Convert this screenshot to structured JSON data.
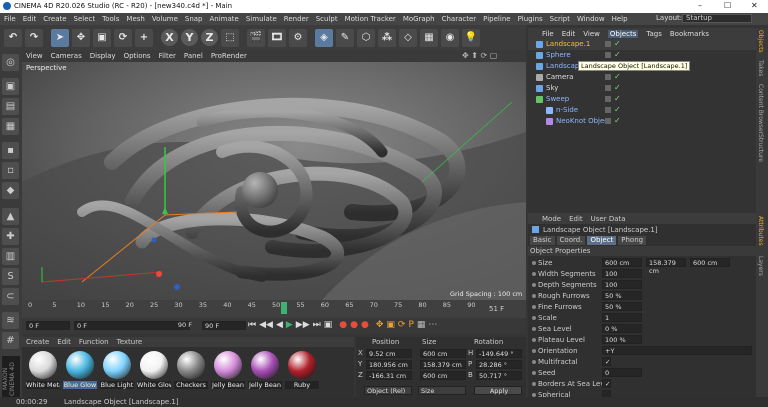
{
  "window": {
    "title": "CINEMA 4D R20.026 Studio (RC - R20) - [new340.c4d *] - Main"
  },
  "menu": [
    "File",
    "Edit",
    "Create",
    "Select",
    "Tools",
    "Mesh",
    "Volume",
    "Snap",
    "Animate",
    "Simulate",
    "Render",
    "Sculpt",
    "Motion Tracker",
    "MoGraph",
    "Character",
    "Pipeline",
    "Plugins",
    "Script",
    "Window",
    "Help"
  ],
  "layout": {
    "label": "Layout:",
    "value": "Startup"
  },
  "toolbar": {
    "axes": [
      "X",
      "Y",
      "Z"
    ]
  },
  "viewport": {
    "menu": [
      "View",
      "Cameras",
      "Display",
      "Options",
      "Filter",
      "Panel",
      "ProRender"
    ],
    "label": "Perspective",
    "grid_spacing": "Grid Spacing : 100 cm"
  },
  "timeline": {
    "ticks": [
      "0",
      "5",
      "10",
      "15",
      "20",
      "25",
      "30",
      "35",
      "40",
      "45",
      "50",
      "55",
      "60",
      "65",
      "70",
      "75",
      "80",
      "85",
      "90"
    ],
    "current": "51 F",
    "current_mark": "51"
  },
  "transport": {
    "start": "0 F",
    "cur": "0 F",
    "end1": "90 F",
    "end2": "90 F"
  },
  "materials": {
    "menu": [
      "Create",
      "Edit",
      "Function",
      "Texture"
    ],
    "items": [
      {
        "name": "White Meta",
        "color": "#d9d9d9"
      },
      {
        "name": "Blue Glow",
        "color": "#49b6e0"
      },
      {
        "name": "Blue Light",
        "color": "#7fd3ff"
      },
      {
        "name": "White Glow",
        "color": "#f2f2f2"
      },
      {
        "name": "Checkers",
        "color": "#888888"
      },
      {
        "name": "Jelly Bean",
        "color": "#d48cd9"
      },
      {
        "name": "Jelly Bean",
        "color": "#a84fb5"
      },
      {
        "name": "Ruby",
        "color": "#b0202a"
      }
    ]
  },
  "coords": {
    "headers": [
      "Position",
      "Size",
      "Rotation"
    ],
    "rows": [
      {
        "axis": "X",
        "pos": "9.52 cm",
        "size": "600 cm",
        "rl": "H",
        "rot": "-149.649 °"
      },
      {
        "axis": "Y",
        "pos": "180.956 cm",
        "size": "158.379 cm",
        "rl": "P",
        "rot": "28.286 °"
      },
      {
        "axis": "Z",
        "pos": "-166.31 cm",
        "size": "600 cm",
        "rl": "B",
        "rot": "50.717 °"
      }
    ],
    "mode": "Object (Rel)",
    "size_mode": "Size",
    "apply": "Apply"
  },
  "objmgr": {
    "tabs": [
      "File",
      "Edit",
      "View",
      "Objects",
      "Tags",
      "Bookmarks"
    ],
    "objects": [
      {
        "name": "Landscape.1",
        "indent": 0,
        "color": "#6aa6e8"
      },
      {
        "name": "Sphere",
        "indent": 0,
        "color": "#6aa6e8"
      },
      {
        "name": "Landscape",
        "indent": 0,
        "color": "#6aa6e8"
      },
      {
        "name": "Camera",
        "indent": 0,
        "color": "#aaaaaa"
      },
      {
        "name": "Sky",
        "indent": 0,
        "color": "#6aa6e8"
      },
      {
        "name": "Sweep",
        "indent": 0,
        "color": "#66c466"
      },
      {
        "name": "n-Side",
        "indent": 1,
        "color": "#8fb7ff"
      },
      {
        "name": "NeoKnot Object",
        "indent": 1,
        "color": "#b38ae6"
      }
    ],
    "tooltip": "Landscape Object [Landscape.1]"
  },
  "attrmgr": {
    "tabs": [
      "Mode",
      "Edit",
      "User Data"
    ],
    "object_name": "Landscape Object [Landscape.1]",
    "subtabs": [
      "Basic",
      "Coord.",
      "Object",
      "Phong"
    ],
    "section": "Object Properties",
    "props": [
      {
        "label": "Size",
        "v1": "600 cm",
        "v2": "158.379 cm",
        "v3": "600 cm"
      },
      {
        "label": "Width Segments",
        "v1": "100"
      },
      {
        "label": "Depth Segments",
        "v1": "100"
      },
      {
        "label": "Rough Furrows",
        "v1": "50 %"
      },
      {
        "label": "Fine Furrows",
        "v1": "50 %"
      },
      {
        "label": "Scale",
        "v1": "1"
      },
      {
        "label": "Sea Level",
        "v1": "0 %"
      },
      {
        "label": "Plateau Level",
        "v1": "100 %"
      },
      {
        "label": "Orientation",
        "v1": "+Y"
      },
      {
        "label": "Multifractal",
        "v1": "✓"
      },
      {
        "label": "Seed",
        "v1": "0"
      },
      {
        "label": "Borders At Sea Level",
        "v1": "✓"
      },
      {
        "label": "Spherical",
        "v1": ""
      }
    ]
  },
  "rightstrip": [
    "Objects",
    "Takes",
    "Content Browser",
    "Structure",
    "Attributes",
    "Layers"
  ],
  "status": {
    "time": "00:00:29",
    "message": "Landscape Object [Landscape.1]"
  }
}
